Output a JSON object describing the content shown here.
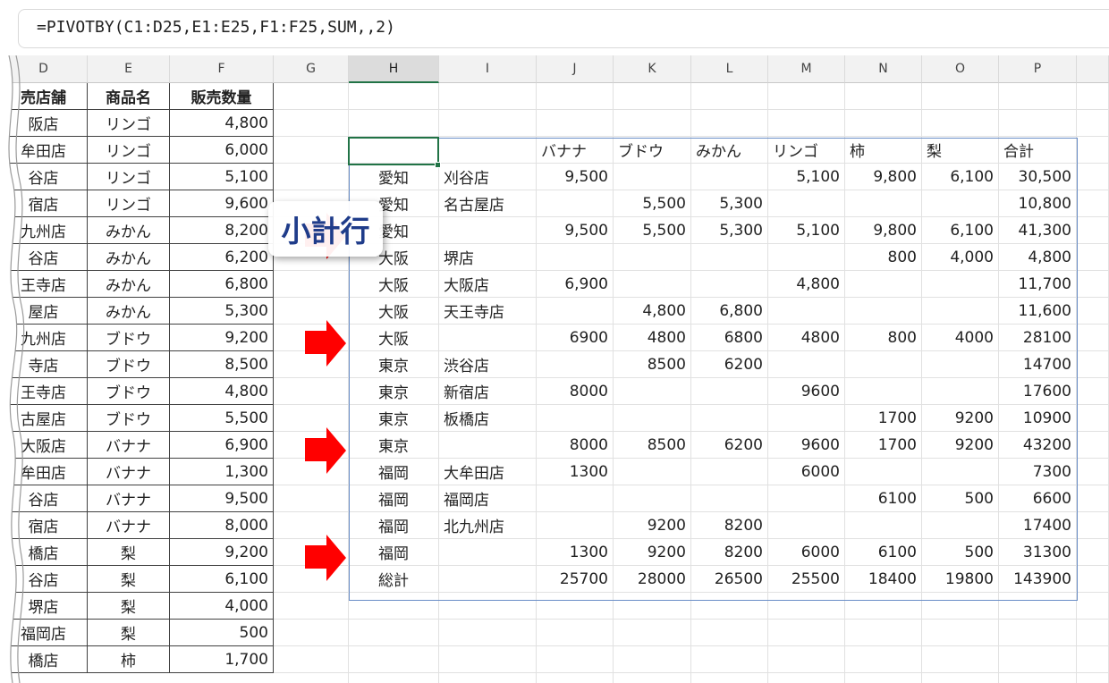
{
  "formula_bar": {
    "formula": "=PIVOTBY(C1:D25,E1:E25,F1:F25,SUM,,2)"
  },
  "column_headers": [
    "D",
    "E",
    "F",
    "G",
    "H",
    "I",
    "J",
    "K",
    "L",
    "M",
    "N",
    "O",
    "P"
  ],
  "selected_column": "H",
  "source_table": {
    "headers": [
      "売店舗",
      "商品名",
      "販売数量"
    ],
    "rows": [
      [
        "阪店",
        "リンゴ",
        "4,800"
      ],
      [
        "牟田店",
        "リンゴ",
        "6,000"
      ],
      [
        "谷店",
        "リンゴ",
        "5,100"
      ],
      [
        "宿店",
        "リンゴ",
        "9,600"
      ],
      [
        "九州店",
        "みかん",
        "8,200"
      ],
      [
        "谷店",
        "みかん",
        "6,200"
      ],
      [
        "王寺店",
        "みかん",
        "6,800"
      ],
      [
        "屋店",
        "みかん",
        "5,300"
      ],
      [
        "九州店",
        "ブドウ",
        "9,200"
      ],
      [
        "寺店",
        "ブドウ",
        "8,500"
      ],
      [
        "王寺店",
        "ブドウ",
        "4,800"
      ],
      [
        "古屋店",
        "ブドウ",
        "5,500"
      ],
      [
        "大阪店",
        "バナナ",
        "6,900"
      ],
      [
        "牟田店",
        "バナナ",
        "1,300"
      ],
      [
        "谷店",
        "バナナ",
        "9,500"
      ],
      [
        "宿店",
        "バナナ",
        "8,000"
      ],
      [
        "橋店",
        "梨",
        "9,200"
      ],
      [
        "谷店",
        "梨",
        "6,100"
      ],
      [
        "堺店",
        "梨",
        "4,000"
      ],
      [
        "福岡店",
        "梨",
        "500"
      ],
      [
        "橋店",
        "柿",
        "1,700"
      ]
    ]
  },
  "pivot": {
    "headers": [
      "",
      "",
      "バナナ",
      "ブドウ",
      "みかん",
      "リンゴ",
      "柿",
      "梨",
      "合計"
    ],
    "rows": [
      [
        "愛知",
        "刈谷店",
        "9,500",
        "",
        "",
        "5,100",
        "9,800",
        "6,100",
        "30,500"
      ],
      [
        "愛知",
        "名古屋店",
        "",
        "5,500",
        "5,300",
        "",
        "",
        "",
        "10,800"
      ],
      [
        "愛知",
        "",
        "9,500",
        "5,500",
        "5,300",
        "5,100",
        "9,800",
        "6,100",
        "41,300"
      ],
      [
        "大阪",
        "堺店",
        "",
        "",
        "",
        "",
        "800",
        "4,000",
        "4,800"
      ],
      [
        "大阪",
        "大阪店",
        "6,900",
        "",
        "",
        "4,800",
        "",
        "",
        "11,700"
      ],
      [
        "大阪",
        "天王寺店",
        "",
        "4,800",
        "6,800",
        "",
        "",
        "",
        "11,600"
      ],
      [
        "大阪",
        "",
        "6900",
        "4800",
        "6800",
        "4800",
        "800",
        "4000",
        "28100"
      ],
      [
        "東京",
        "渋谷店",
        "",
        "8500",
        "6200",
        "",
        "",
        "",
        "14700"
      ],
      [
        "東京",
        "新宿店",
        "8000",
        "",
        "",
        "9600",
        "",
        "",
        "17600"
      ],
      [
        "東京",
        "板橋店",
        "",
        "",
        "",
        "",
        "1700",
        "9200",
        "10900"
      ],
      [
        "東京",
        "",
        "8000",
        "8500",
        "6200",
        "9600",
        "1700",
        "9200",
        "43200"
      ],
      [
        "福岡",
        "大牟田店",
        "1300",
        "",
        "",
        "6000",
        "",
        "",
        "7300"
      ],
      [
        "福岡",
        "福岡店",
        "",
        "",
        "",
        "",
        "6100",
        "500",
        "6600"
      ],
      [
        "福岡",
        "北九州店",
        "",
        "9200",
        "8200",
        "",
        "",
        "",
        "17400"
      ],
      [
        "福岡",
        "",
        "1300",
        "9200",
        "8200",
        "6000",
        "6100",
        "500",
        "31300"
      ],
      [
        "総計",
        "",
        "25700",
        "28000",
        "26500",
        "25500",
        "18400",
        "19800",
        "143900"
      ]
    ]
  },
  "annotation": {
    "label": "小計行",
    "arrow_color": "#ff0000"
  }
}
